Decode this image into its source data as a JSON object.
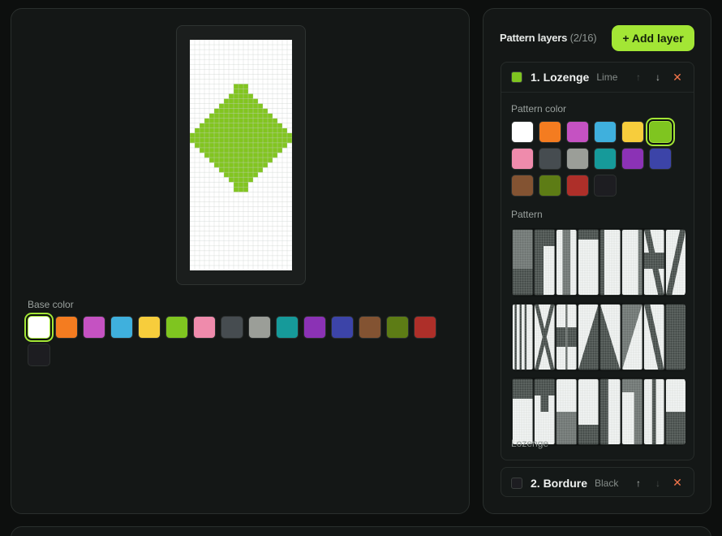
{
  "canvas": {
    "base_label": "Base color",
    "base_selected_index": 0,
    "cols": 21,
    "rows": 47,
    "base_color": "#ffffff",
    "pattern_color": "#82c520",
    "grid_line_color": "#c8d0cc",
    "lozenge_rows": [
      [
        9,
        11
      ],
      [
        9,
        11
      ],
      [
        8,
        12
      ],
      [
        7,
        13
      ],
      [
        6,
        14
      ],
      [
        5,
        15
      ],
      [
        4,
        16
      ],
      [
        3,
        17
      ],
      [
        2,
        18
      ],
      [
        1,
        19
      ],
      [
        0,
        20
      ],
      [
        0,
        20
      ],
      [
        1,
        19
      ],
      [
        2,
        18
      ],
      [
        3,
        17
      ],
      [
        4,
        16
      ],
      [
        5,
        15
      ],
      [
        6,
        14
      ],
      [
        7,
        13
      ],
      [
        8,
        12
      ],
      [
        9,
        11
      ],
      [
        9,
        11
      ]
    ],
    "lozenge_start_row": 9
  },
  "palette": [
    {
      "name": "White",
      "hex": "#ffffff"
    },
    {
      "name": "Orange",
      "hex": "#f47c20"
    },
    {
      "name": "Magenta",
      "hex": "#c552c2"
    },
    {
      "name": "Light blue",
      "hex": "#3fb0dd"
    },
    {
      "name": "Yellow",
      "hex": "#f7cd3c"
    },
    {
      "name": "Lime",
      "hex": "#7fc520"
    },
    {
      "name": "Pink",
      "hex": "#ef8bac"
    },
    {
      "name": "Gray",
      "hex": "#464c50"
    },
    {
      "name": "Light gray",
      "hex": "#9b9e98"
    },
    {
      "name": "Cyan",
      "hex": "#169a9a"
    },
    {
      "name": "Purple",
      "hex": "#8b32b5"
    },
    {
      "name": "Blue",
      "hex": "#3c44a8"
    },
    {
      "name": "Brown",
      "hex": "#835332"
    },
    {
      "name": "Green",
      "hex": "#5d7c15"
    },
    {
      "name": "Red",
      "hex": "#ae2f29"
    },
    {
      "name": "Black",
      "hex": "#1d1d21"
    }
  ],
  "layers_panel": {
    "title": "Pattern layers",
    "count": "(2/16)",
    "add_button": "+ Add layer"
  },
  "layers": [
    {
      "number_name": "1. Lozenge",
      "color_name": "Lime",
      "color": "#7fc520",
      "pattern_color_label": "Pattern color",
      "pattern_label": "Pattern",
      "selected_color_index": 5,
      "selected_pattern": "Lozenge",
      "up_enabled": false,
      "down_enabled": true,
      "close": "✕"
    },
    {
      "number_name": "2. Bordure",
      "color_name": "Black",
      "color": "#1d1d21",
      "up_enabled": true,
      "down_enabled": false,
      "close": "✕"
    }
  ],
  "icons": {
    "up": "↑",
    "down": "↓"
  }
}
